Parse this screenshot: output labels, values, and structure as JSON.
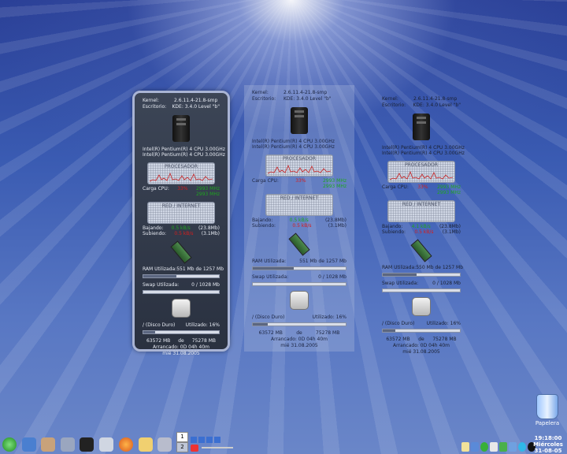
{
  "panels": [
    {
      "kernel_label": "Kernel:",
      "kernel": "2.6.11.4-21.8-smp",
      "desktop_label": "Escritorio:",
      "desktop": "KDE: 3.4.0 Level \"b\"",
      "cpu_lines": [
        "Intel(R) Pentium(R) 4 CPU 3.00GHz",
        "Intel(R) Pentium(R) 4 CPU 3.00GHz"
      ],
      "processor_title": "PROCESADOR",
      "cpu_load_label": "Carga CPU:",
      "cpu_load": "33%",
      "cpu_mhz1": "2993 MHz",
      "cpu_mhz2": "2993 MHz",
      "network_title": "RED / INTERNET",
      "down_label": "Bajando:",
      "down_rate": "0.5 kB/s",
      "down_total": "(23.8Mb)",
      "up_label": "Subiendo:",
      "up_rate": "0.5 kB/s",
      "up_total": "(3.1Mb)",
      "ram_label": "RAM Utilizada:",
      "ram_value": "551 Mb de 1257 Mb",
      "ram_fill": 0.44,
      "swap_label": "Swap Utilizada:",
      "swap_value": "0 / 1028 Mb",
      "swap_fill": 0.0,
      "disk_label": "/ (Disco Duro)",
      "disk_used": "Utilizado: 16%",
      "disk_fill": 0.16,
      "disk_free": "63572 MB",
      "disk_of": "de",
      "disk_total": "75278 MB",
      "uptime": "Arrancado: 0D 04h 40m",
      "date": "mié 31.08.2005"
    },
    {
      "kernel_label": "Kernel:",
      "kernel": "2.6.11.4-21.8-smp",
      "desktop_label": "Escritorio:",
      "desktop": "KDE: 3.4.0 Level \"b\"",
      "cpu_lines": [
        "Intel(R) Pentium(R) 4 CPU 3.00GHz",
        "Intel(R) Pentium(R) 4 CPU 3.00GHz"
      ],
      "processor_title": "PROCESADOR",
      "cpu_load_label": "Carga CPU:",
      "cpu_load": "33%",
      "cpu_mhz1": "2993 MHz",
      "cpu_mhz2": "2993 MHz",
      "network_title": "RED / INTERNET",
      "down_label": "Bajando:",
      "down_rate": "0.5 kB/s",
      "down_total": "(23.8Mb)",
      "up_label": "Subiendo:",
      "up_rate": "0.5 kB/s",
      "up_total": "(3.1Mb)",
      "ram_label": "RAM Utilizada:",
      "ram_value": "551 Mb de 1257 Mb",
      "ram_fill": 0.44,
      "swap_label": "Swap Utilizada:",
      "swap_value": "0 / 1028 Mb",
      "swap_fill": 0.0,
      "disk_label": "/ (Disco Duro)",
      "disk_used": "Utilizado: 16%",
      "disk_fill": 0.16,
      "disk_free": "63572 MB",
      "disk_of": "de",
      "disk_total": "75278 MB",
      "uptime": "Arrancado: 0D 04h 40m",
      "date": "mié 31.08.2005"
    },
    {
      "kernel_label": "Kernel:",
      "kernel": "2.6.11.4-21.8-smp",
      "desktop_label": "Escritorio:",
      "desktop": "KDE: 3.4.0 Level \"b\"",
      "cpu_lines": [
        "Intel(R) Pentium(R) 4 CPU 3.00GHz",
        "Intel(R) Pentium(R) 4 CPU 3.00GHz"
      ],
      "processor_title": "PROCESADOR",
      "cpu_load_label": "Carga CPU:",
      "cpu_load": "33%",
      "cpu_mhz1": "2993 MHz",
      "cpu_mhz2": "2993 MHz",
      "network_title": "RED / INTERNET",
      "down_label": "Bajando:",
      "down_rate": "4.1 kB/s",
      "down_total": "(23.8Mb)",
      "up_label": "Subiendo:",
      "up_rate": "0.5 kB/s",
      "up_total": "(3.1Mb)",
      "ram_label": "RAM Utilizada:",
      "ram_value": "550 Mb de 1257 Mb",
      "ram_fill": 0.44,
      "swap_label": "Swap Utilizada:",
      "swap_value": "0 / 1028 Mb",
      "swap_fill": 0.0,
      "disk_label": "/ (Disco Duro)",
      "disk_used": "Utilizado: 16%",
      "disk_fill": 0.16,
      "disk_free": "63572 MB",
      "disk_of": "de",
      "disk_total": "75278 MB",
      "uptime": "Arrancado: 0D 04h 40m",
      "date": "mié 31.08.2005"
    }
  ],
  "desktop": {
    "trash_label": "Papelera"
  },
  "taskbar": {
    "launchers": [
      "kmenu-icon",
      "home-folder-icon",
      "user-icon",
      "computer-icon",
      "terminal-icon",
      "printer-icon",
      "firefox-icon",
      "kmail-icon",
      "gaim-icon"
    ],
    "pager": [
      "1",
      "2"
    ],
    "tray": [
      "klipper-icon",
      "network-icon",
      "kopete-icon",
      "battery-icon",
      "korganizer-icon",
      "mixer-icon",
      "update-icon",
      "bomb-icon"
    ]
  },
  "clock": {
    "time": "19:18:00",
    "day": "Miércoles",
    "date": "31-08-05"
  }
}
